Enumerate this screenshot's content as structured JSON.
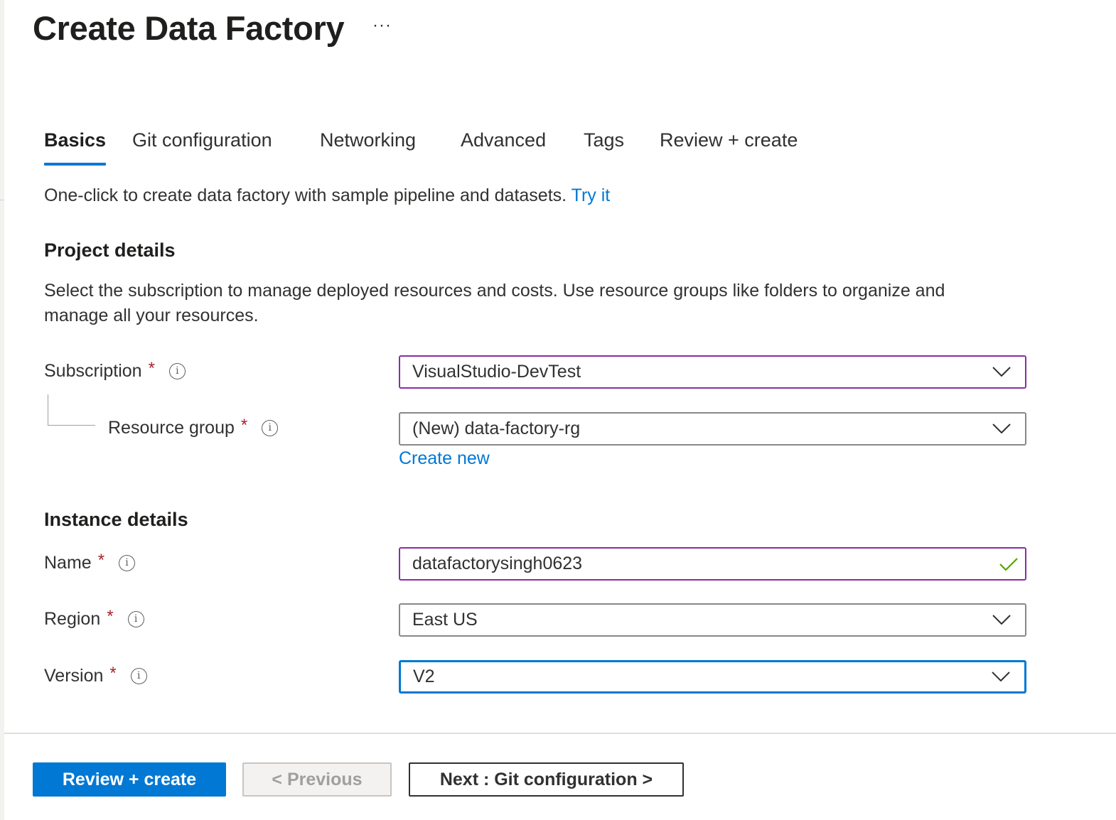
{
  "header": {
    "title": "Create Data Factory",
    "more_label": "···"
  },
  "tabs": [
    {
      "label": "Basics",
      "active": true
    },
    {
      "label": "Git configuration",
      "active": false
    },
    {
      "label": "Networking",
      "active": false
    },
    {
      "label": "Advanced",
      "active": false
    },
    {
      "label": "Tags",
      "active": false
    },
    {
      "label": "Review + create",
      "active": false
    }
  ],
  "intro": {
    "text": "One-click to create data factory with sample pipeline and datasets. ",
    "link": "Try it"
  },
  "project_details": {
    "heading": "Project details",
    "description": "Select the subscription to manage deployed resources and costs. Use resource groups like folders to organize and manage all your resources.",
    "subscription": {
      "label": "Subscription",
      "required": "*",
      "value": "VisualStudio-DevTest"
    },
    "resource_group": {
      "label": "Resource group",
      "required": "*",
      "value": "(New) data-factory-rg",
      "create_new": "Create new"
    }
  },
  "instance_details": {
    "heading": "Instance details",
    "name": {
      "label": "Name",
      "required": "*",
      "value": "datafactorysingh0623",
      "valid": true
    },
    "region": {
      "label": "Region",
      "required": "*",
      "value": "East US"
    },
    "version": {
      "label": "Version",
      "required": "*",
      "value": "V2"
    }
  },
  "icons": {
    "info": "i"
  },
  "footer": {
    "review_create": "Review + create",
    "previous": "< Previous",
    "next": "Next : Git configuration >"
  },
  "colors": {
    "accent": "#0078d4",
    "focus_purple": "#8a2da5",
    "required": "#a4262c",
    "valid_check": "#57a300"
  }
}
